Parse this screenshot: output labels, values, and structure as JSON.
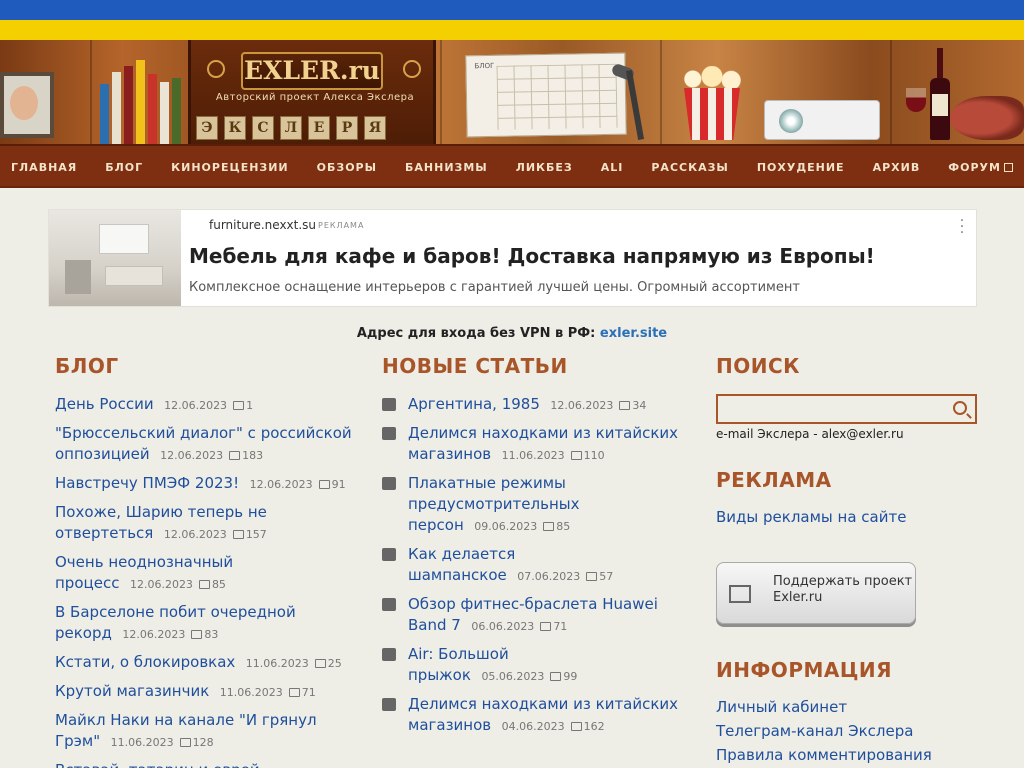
{
  "header": {
    "logo_title": "EXLER.ru",
    "logo_subtitle": "Авторский проект Алекса Экслера",
    "letter_blocks": [
      "Э",
      "К",
      "С",
      "Л",
      "Е",
      "Р",
      "Я"
    ],
    "calendar_label": "БЛОГ"
  },
  "nav": {
    "items": [
      {
        "label": "ГЛАВНАЯ"
      },
      {
        "label": "БЛОГ"
      },
      {
        "label": "КИНОРЕЦЕНЗИИ"
      },
      {
        "label": "ОБЗОРЫ"
      },
      {
        "label": "БАННИЗМЫ"
      },
      {
        "label": "ЛИКБЕЗ"
      },
      {
        "label": "ALI"
      },
      {
        "label": "РАССКАЗЫ"
      },
      {
        "label": "ПОХУДЕНИЕ"
      },
      {
        "label": "АРХИВ"
      },
      {
        "label": "ФОРУМ"
      }
    ]
  },
  "ad": {
    "domain": "furniture.nexxt.su",
    "tag": "РЕКЛАМА",
    "title": "Мебель для кафе и баров! Доставка напрямую из Европы!",
    "description": "Комплексное оснащение интерьеров с гарантией лучшей цены. Огромный ассортимент"
  },
  "vpn": {
    "text": "Адрес для входа без VPN в РФ:",
    "link": "exler.site"
  },
  "blog": {
    "title": "БЛОГ",
    "items": [
      {
        "title": "День России",
        "date": "12.06.2023",
        "comments": "1"
      },
      {
        "title": "\"Брюссельский диалог\" с российской оппозицией",
        "date": "12.06.2023",
        "comments": "183"
      },
      {
        "title": "Навстречу ПМЭФ 2023!",
        "date": "12.06.2023",
        "comments": "91"
      },
      {
        "title": "Похоже, Шарию теперь не отвертеться",
        "date": "12.06.2023",
        "comments": "157"
      },
      {
        "title": "Очень неоднозначный процесс",
        "date": "12.06.2023",
        "comments": "85"
      },
      {
        "title": "В Барселоне побит очередной рекорд",
        "date": "12.06.2023",
        "comments": "83"
      },
      {
        "title": "Кстати, о блокировках",
        "date": "11.06.2023",
        "comments": "25"
      },
      {
        "title": "Крутой магазинчик",
        "date": "11.06.2023",
        "comments": "71"
      },
      {
        "title": "Майкл Наки на канале \"И грянул Грэм\"",
        "date": "11.06.2023",
        "comments": "128"
      },
      {
        "title": "Вставай, татарин и еврей",
        "date": "",
        "comments": ""
      }
    ]
  },
  "articles": {
    "title": "НОВЫЕ СТАТЬИ",
    "items": [
      {
        "title": "Аргентина, 1985",
        "date": "12.06.2023",
        "comments": "34",
        "icon": "film-icon"
      },
      {
        "title": "Делимся находками из китайских магазинов",
        "date": "11.06.2023",
        "comments": "110",
        "icon": "question-icon"
      },
      {
        "title": "Плакатные режимы предусмотрительных персон",
        "date": "09.06.2023",
        "comments": "85",
        "icon": "smiley-icon"
      },
      {
        "title": "Как делается шампанское",
        "date": "07.06.2023",
        "comments": "57",
        "icon": "pencil-icon"
      },
      {
        "title": "Обзор фитнес-браслета Huawei Band 7",
        "date": "06.06.2023",
        "comments": "71",
        "icon": "checklist-icon"
      },
      {
        "title": "Air: Большой прыжок",
        "date": "05.06.2023",
        "comments": "99",
        "icon": "film-icon"
      },
      {
        "title": "Делимся находками из китайских магазинов",
        "date": "04.06.2023",
        "comments": "162",
        "icon": "question-icon"
      }
    ]
  },
  "sidebar": {
    "search_title": "ПОИСК",
    "search_placeholder": "",
    "email": "e-mail Экслера - alex@exler.ru",
    "ads_title": "РЕКЛАМА",
    "ads_link": "Виды рекламы на сайте",
    "support_button": "Поддержать проект Exler.ru",
    "info_title": "ИНФОРМАЦИЯ",
    "info_links": [
      "Личный кабинет",
      "Телеграм-канал Экслера",
      "Правила комментирования"
    ]
  },
  "colors": {
    "flag_blue": "#1f5bbd",
    "flag_yellow": "#f4d000",
    "nav_bg": "#7e2e11",
    "section_title": "#a8552a",
    "link": "#1f4f9c"
  }
}
